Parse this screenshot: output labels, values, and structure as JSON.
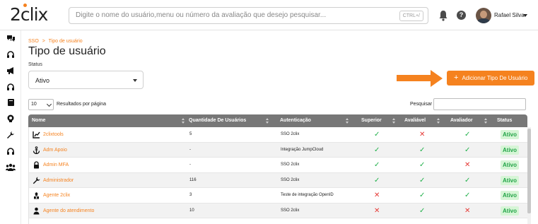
{
  "header": {
    "logo": "2clix",
    "search_placeholder": "Digite o nome do usuário,menu ou número da avaliação que desejo pesquisar...",
    "search_shortcut": "CTRL+/",
    "help_label": "?",
    "user_name": "Rafael Silva"
  },
  "sidebar": {
    "icons": [
      "chat-icon",
      "headset-icon",
      "megaphone-icon",
      "headphones-icon",
      "book-icon",
      "lightbulb-icon",
      "wrench-icon",
      "support-icon",
      "users-icon"
    ]
  },
  "breadcrumb": {
    "root": "SSO",
    "separator": ">",
    "current": "Tipo de usuário"
  },
  "page_title": "Tipo de usuário",
  "filters": {
    "status_label": "Status",
    "status_value": "Ativo",
    "per_page_value": "10",
    "per_page_label": "Resultados por página",
    "search_label": "Pesquisar"
  },
  "add_button": {
    "plus": "+",
    "label": "Adicionar Tipo De Usuário"
  },
  "colors": {
    "accent": "#f5821f",
    "header_bg": "#777777",
    "check": "#22b14c",
    "cross": "#e53935",
    "badge_bg": "#d6f5d6"
  },
  "table": {
    "columns": [
      "Nome",
      "Quantidade De Usuários",
      "Autenticação",
      "Superior",
      "Avaliável",
      "Avaliador",
      "Status"
    ],
    "rows": [
      {
        "icon": "chart-icon",
        "name": "2clixtools",
        "qty": "5",
        "auth": "SSO 2clix",
        "superior": true,
        "avaliavel": false,
        "avaliador": true,
        "status": "Ativo"
      },
      {
        "icon": "anchor-icon",
        "name": "Adm Apoio",
        "qty": "-",
        "auth": "Integração JumpCloud",
        "superior": true,
        "avaliavel": true,
        "avaliador": true,
        "status": "Ativo"
      },
      {
        "icon": "lock-icon",
        "name": "Admin MFA",
        "qty": "-",
        "auth": "SSO 2clix",
        "superior": true,
        "avaliavel": true,
        "avaliador": false,
        "status": "Ativo"
      },
      {
        "icon": "wrench-icon",
        "name": "Administrador",
        "qty": "116",
        "auth": "SSO 2clix",
        "superior": true,
        "avaliavel": true,
        "avaliador": true,
        "status": "Ativo"
      },
      {
        "icon": "agent-icon",
        "name": "Agente 2clix",
        "qty": "3",
        "auth": "Teste de integração OpenID",
        "superior": false,
        "avaliavel": true,
        "avaliador": true,
        "status": "Ativo"
      },
      {
        "icon": "user-icon",
        "name": "Agente do atendimento",
        "qty": "10",
        "auth": "SSO 2clix",
        "superior": false,
        "avaliavel": true,
        "avaliador": false,
        "status": "Ativo"
      }
    ]
  }
}
